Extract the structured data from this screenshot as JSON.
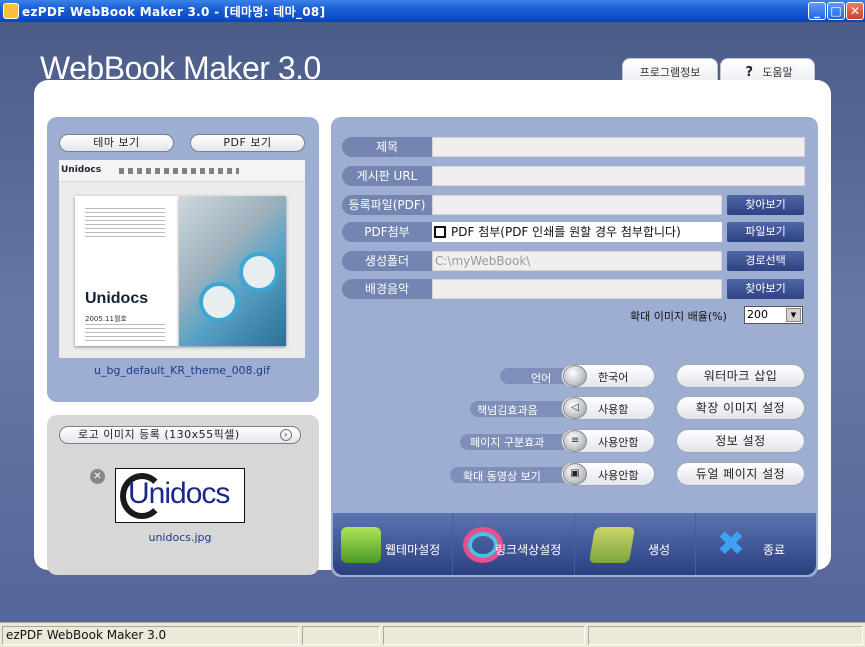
{
  "window": {
    "title": "ezPDF WebBook Maker 3.0 - [테마명: 테마_08]",
    "minimize": "_",
    "maximize": "□",
    "close": "✕"
  },
  "app_title": "WebBook Maker 3.0",
  "tabs": {
    "program_info": "프로그램정보",
    "help": "도움말",
    "help_icon": "?"
  },
  "preview": {
    "theme_view": "테마 보기",
    "pdf_view": "PDF 보기",
    "caption": "u_bg_default_KR_theme_008.gif",
    "logo_text": "Unidocs",
    "date_text": "2005.11월호"
  },
  "logo": {
    "register_label": "로고 이미지 등록 (130x55픽셀)",
    "arrow_icon": "›",
    "remove_icon": "✕",
    "image_text": "Unidocs",
    "caption": "unidocs.jpg"
  },
  "form": {
    "title_label": "제목",
    "board_url_label": "게시판 URL",
    "register_file_label": "등록파일(PDF)",
    "pdf_attach_label": "PDF첨부",
    "pdf_attach_checkbox": "PDF 첨부(PDF 인쇄를 원할 경우 첨부합니다)",
    "output_folder_label": "생성폴더",
    "output_folder_value": "C:\\myWebBook\\",
    "bgm_label": "배경음악",
    "browse": "찾아보기",
    "file_browse": "파일보기",
    "path_select": "경로선택",
    "browse2": "찾아보기",
    "zoom_label": "확대 이미지 배율(%)",
    "zoom_value": "200",
    "zoom_dd": "▼"
  },
  "options": {
    "language_label": "언어",
    "language_value": "한국어",
    "page_sound_label": "책넘김효과음",
    "page_sound_value": "사용함",
    "page_divider_label": "페이지 구분효과",
    "page_divider_value": "사용안함",
    "zoom_video_label": "확대 동영상 보기",
    "zoom_video_value": "사용안함",
    "watermark": "워터마크 삽입",
    "ext_image": "확장 이미지 설정",
    "info_setting": "정보 설정",
    "dual_page": "듀얼 페이지 설정"
  },
  "toolbar": {
    "web_theme": "웹테마설정",
    "link_color": "링크색상설정",
    "make": "생성",
    "exit": "종료",
    "exit_icon": "✖"
  },
  "status": {
    "text": "ezPDF WebBook Maker 3.0"
  }
}
